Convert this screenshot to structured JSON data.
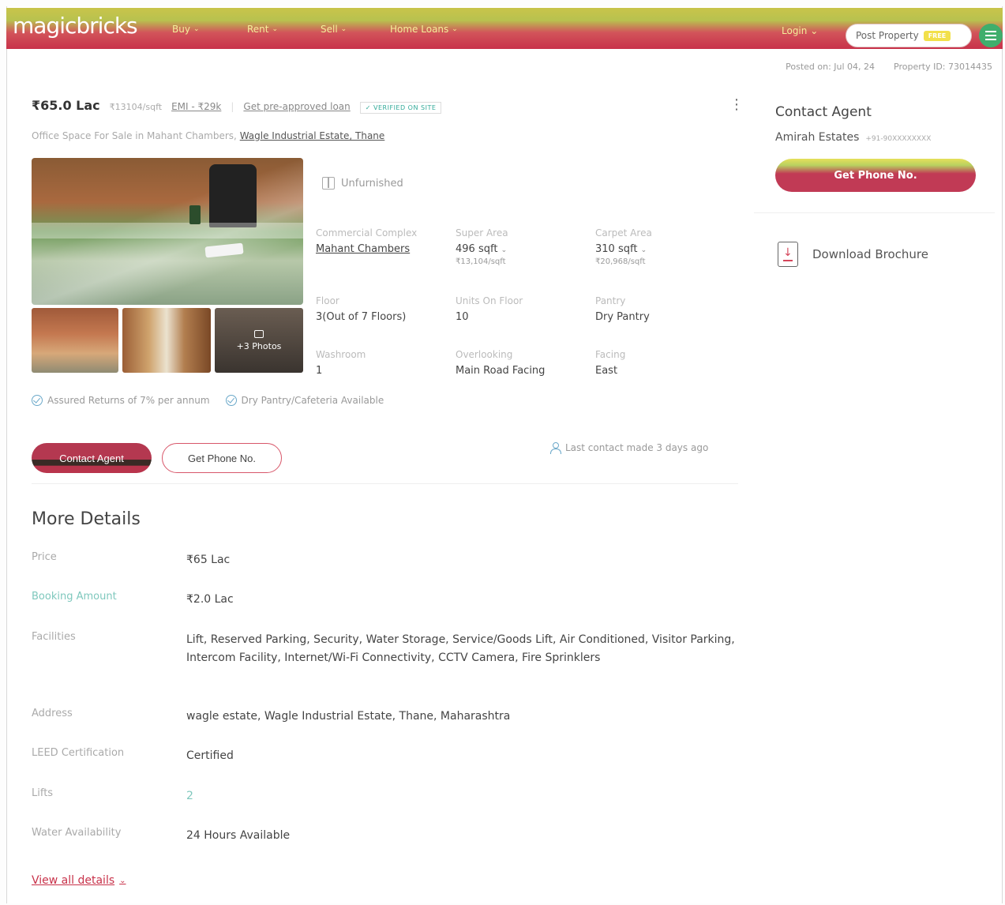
{
  "header": {
    "logo": "magicbricks",
    "nav": [
      {
        "label": "Buy"
      },
      {
        "label": "Rent"
      },
      {
        "label": "Sell"
      },
      {
        "label": "Home Loans"
      }
    ],
    "login": "Login",
    "post_property": "Post Property",
    "free_badge": "FREE"
  },
  "meta": {
    "posted_on": "Posted on: Jul 04, 24",
    "property_id": "Property ID: 73014435"
  },
  "listing": {
    "price": "₹65.0 Lac",
    "price_per_sqft": "₹13104/sqft",
    "emi": "EMI - ₹29k",
    "loan": "Get pre-approved loan",
    "verified": "VERIFIED ON SITE",
    "subtitle": "Office Space For Sale in Mahant Chambers,",
    "location_link": "Wagle Industrial Estate, Thane",
    "photos_label": "+3 Photos",
    "furnishing": "Unfurnished",
    "specs": [
      {
        "label": "Commercial Complex",
        "value": "Mahant Chambers",
        "sub": ""
      },
      {
        "label": "Super Area",
        "value": "496 sqft",
        "sub": "₹13,104/sqft"
      },
      {
        "label": "Carpet Area",
        "value": "310 sqft",
        "sub": "₹20,968/sqft"
      },
      {
        "label": "Floor",
        "value": "3(Out of 7 Floors)",
        "sub": ""
      },
      {
        "label": "Units On Floor",
        "value": "10",
        "sub": ""
      },
      {
        "label": "Pantry",
        "value": "Dry Pantry",
        "sub": ""
      },
      {
        "label": "Washroom",
        "value": "1",
        "sub": ""
      },
      {
        "label": "Overlooking",
        "value": "Main Road Facing",
        "sub": ""
      },
      {
        "label": "Facing",
        "value": "East",
        "sub": ""
      }
    ],
    "features": [
      "Assured Returns of 7% per annum",
      "Dry Pantry/Cafeteria Available"
    ],
    "contact_agent": "Contact Agent",
    "get_phone": "Get Phone No.",
    "last_contact": "Last contact made 3 days ago"
  },
  "more_details": {
    "title": "More Details",
    "rows": [
      {
        "label": "Price",
        "value": "₹65 Lac"
      },
      {
        "label": "Booking Amount",
        "value": "₹2.0 Lac"
      },
      {
        "label": "Facilities",
        "value": "Lift, Reserved Parking, Security, Water Storage, Service/Goods Lift, Air Conditioned, Visitor Parking, Intercom Facility, Internet/Wi-Fi Connectivity, CCTV Camera, Fire Sprinklers"
      },
      {
        "label": "Address",
        "value": "wagle estate, Wagle Industrial Estate, Thane, Maharashtra"
      },
      {
        "label": "LEED Certification",
        "value": "Certified"
      },
      {
        "label": "Lifts",
        "value": "2"
      },
      {
        "label": "Water Availability",
        "value": "24 Hours Available"
      }
    ],
    "view_all": "View all details"
  },
  "sidebar": {
    "title": "Contact Agent",
    "agent_name": "Amirah Estates",
    "agent_phone": "+91-90XXXXXXXX",
    "get_phone": "Get Phone No.",
    "brochure": "Download Brochure"
  },
  "colors": {
    "brand": "#c8324a",
    "accent_teal": "#7fc8bd",
    "check_blue": "#6aa8c9"
  }
}
